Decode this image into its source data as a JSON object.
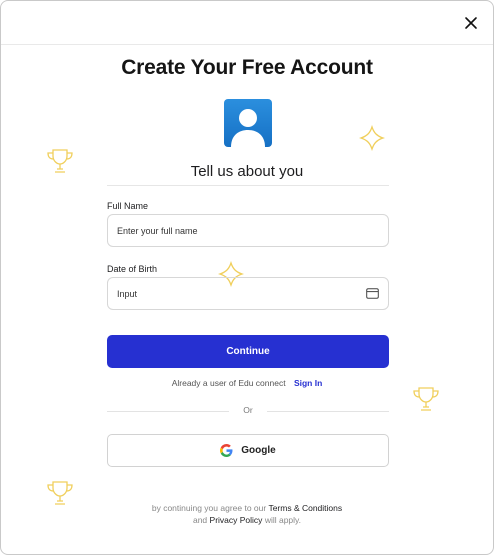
{
  "header": {
    "close_icon": "close-icon"
  },
  "title": "Create Your Free Account",
  "subtitle": "Tell us about you",
  "form": {
    "full_name_label": "Full Name",
    "full_name_placeholder": "Enter your full name",
    "dob_label": "Date of Birth",
    "dob_value": "Input",
    "dob_icon": "calendar-icon"
  },
  "continue_label": "Continue",
  "already": {
    "text": "Already a user of Edu connect",
    "link": "Sign In"
  },
  "or_text": "Or",
  "google_label": "Google",
  "footer": {
    "prefix": "by continuing  you agree to our",
    "terms": "Terms & Conditions",
    "and": "and",
    "privacy": "Privacy Policy",
    "suffix": "will apply."
  },
  "colors": {
    "primary": "#2630d1",
    "avatar": "#1f7fd6",
    "decoration": "#f0cf5c"
  }
}
